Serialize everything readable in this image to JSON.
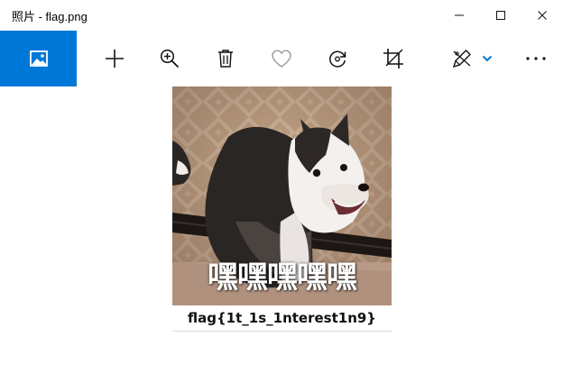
{
  "window": {
    "title": "照片 - flag.png"
  },
  "toolbar": {
    "items": [
      "photos-home-icon",
      "add-icon",
      "zoom-in-icon",
      "delete-icon",
      "favorite-icon",
      "rotate-icon",
      "crop-icon",
      "edit-draw-icon",
      "chevron-down-icon",
      "more-icon"
    ],
    "accent_color": "#0078d7"
  },
  "image": {
    "meme_caption": "嘿嘿嘿嘿嘿",
    "flag_text": "flag{1t_1s_1nterest1n9}"
  }
}
